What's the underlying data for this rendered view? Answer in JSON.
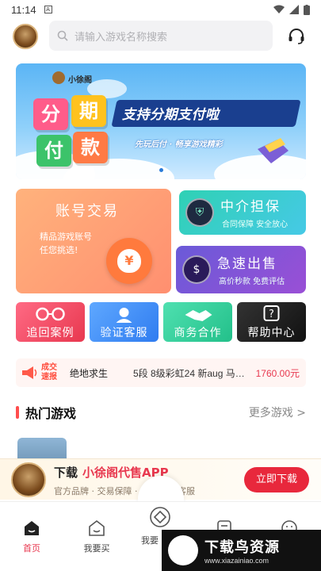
{
  "status": {
    "time": "11:14",
    "notif": "A"
  },
  "search": {
    "placeholder": "请输入游戏名称搜索"
  },
  "banner": {
    "logo_text": "小徐阁",
    "tiles": [
      "分",
      "期",
      "付",
      "款"
    ],
    "slogan": "支持分期支付啦",
    "sub_slogan": "先玩后付 · 畅享游戏精彩"
  },
  "cards": {
    "trade": {
      "title": "账号交易",
      "desc_line1": "精品游戏账号",
      "desc_line2": "任您挑选!"
    },
    "escrow": {
      "title": "中介担保",
      "sub": "合同保障 安全放心"
    },
    "sale": {
      "title": "急速出售",
      "sub": "高价秒款 免费评估"
    }
  },
  "quick": [
    {
      "label": "追回案例",
      "icon": "handcuffs-icon"
    },
    {
      "label": "验证客服",
      "icon": "support-agent-icon"
    },
    {
      "label": "商务合作",
      "icon": "handshake-icon"
    },
    {
      "label": "帮助中心",
      "icon": "help-icon"
    }
  ],
  "ticker": {
    "tag_line1": "成交",
    "tag_line2": "速报",
    "game": "绝地求生",
    "item": "5段 8级彩虹24 新aug 马…",
    "price": "1760.00元"
  },
  "hot": {
    "title": "热门游戏",
    "more": "更多游戏 >"
  },
  "promo": {
    "title_prefix": "下载",
    "title_brand": "小徐阁代售APP",
    "sub": "官方品牌 · 交易保障 · 1对1专属客服",
    "button": "立即下载"
  },
  "tabs": [
    {
      "label": "首页",
      "active": true
    },
    {
      "label": "我要买",
      "active": false
    },
    {
      "label": "我要",
      "active": false
    }
  ],
  "watermark": {
    "main": "下载鸟资源",
    "url": "www.xiazainiao.com"
  },
  "colors": {
    "accent": "#e8384f",
    "banner_blue": "#5bb5f5"
  }
}
